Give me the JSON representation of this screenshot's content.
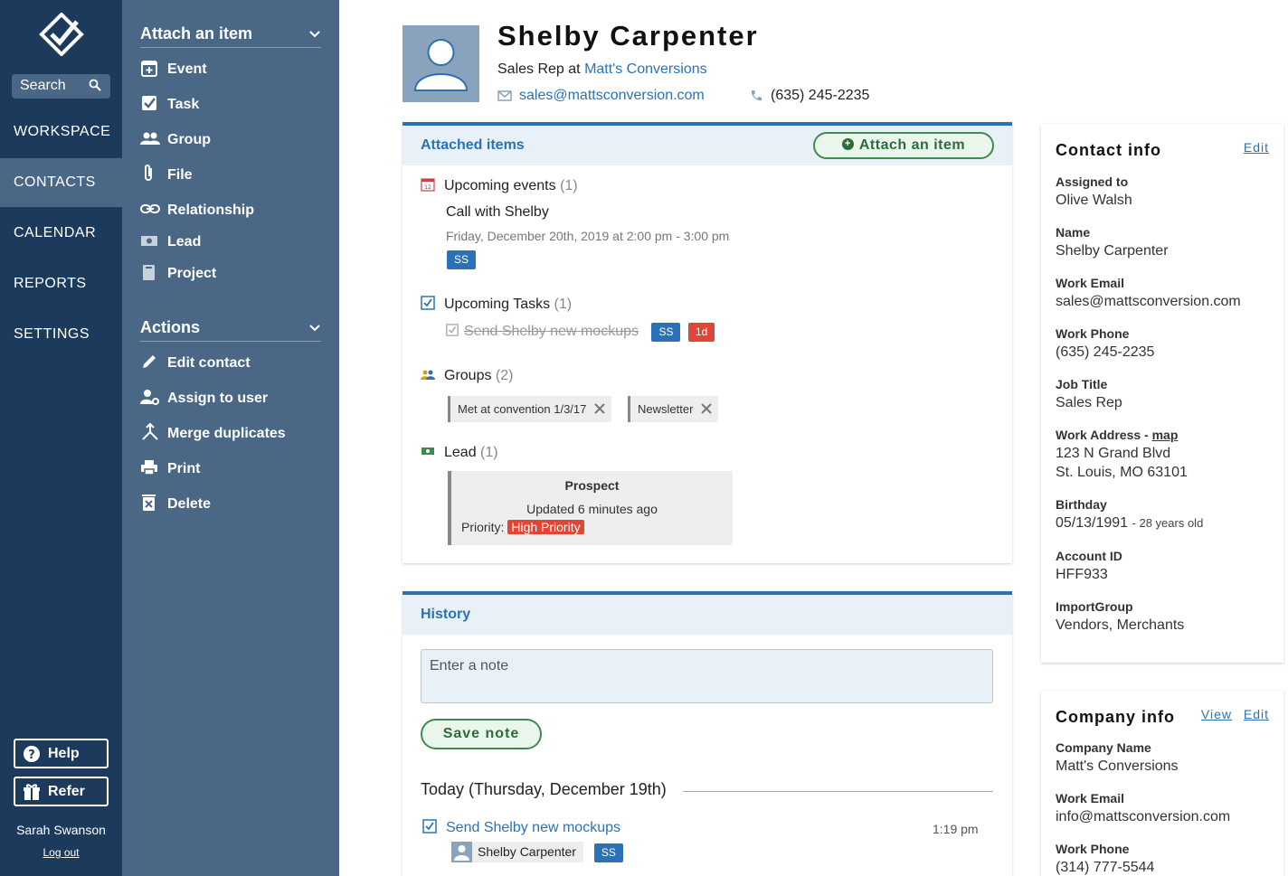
{
  "nav": {
    "search_label": "Search",
    "items": [
      {
        "label": "WORKSPACE"
      },
      {
        "label": "CONTACTS"
      },
      {
        "label": "CALENDAR"
      },
      {
        "label": "REPORTS"
      },
      {
        "label": "SETTINGS"
      }
    ],
    "help_label": "Help",
    "refer_label": "Refer",
    "user_name": "Sarah Swanson",
    "logout_label": "Log out"
  },
  "panel": {
    "attach_heading": "Attach an item",
    "attach_items": [
      {
        "label": "Event",
        "icon": "event-icon"
      },
      {
        "label": "Task",
        "icon": "task-icon"
      },
      {
        "label": "Group",
        "icon": "group-icon"
      },
      {
        "label": "File",
        "icon": "file-icon"
      },
      {
        "label": "Relationship",
        "icon": "relationship-icon"
      },
      {
        "label": "Lead",
        "icon": "lead-icon"
      },
      {
        "label": "Project",
        "icon": "project-icon"
      }
    ],
    "actions_heading": "Actions",
    "action_items": [
      {
        "label": "Edit contact",
        "icon": "pencil-icon"
      },
      {
        "label": "Assign to user",
        "icon": "assign-user-icon"
      },
      {
        "label": "Merge duplicates",
        "icon": "merge-icon"
      },
      {
        "label": "Print",
        "icon": "print-icon"
      },
      {
        "label": "Delete",
        "icon": "trash-icon"
      }
    ]
  },
  "contact": {
    "name": "Shelby Carpenter",
    "role_prefix": "Sales Rep at",
    "company": "Matt's Conversions",
    "email": "sales@mattsconversion.com",
    "phone": "(635) 245-2235"
  },
  "attached": {
    "title": "Attached items",
    "attach_button": "Attach an item",
    "events": {
      "label": "Upcoming events",
      "count": "(1)",
      "event_title": "Call with Shelby",
      "event_time": "Friday, December 20th, 2019 at 2:00 pm - 3:00 pm",
      "badge": "SS"
    },
    "tasks": {
      "label": "Upcoming Tasks",
      "count": "(1)",
      "task_title": "Send Shelby new mockups",
      "badge": "SS",
      "due_badge": "1d"
    },
    "groups": {
      "label": "Groups",
      "count": "(2)",
      "items": [
        "Met at convention 1/3/17",
        "Newsletter"
      ]
    },
    "lead": {
      "label": "Lead",
      "count": "(1)",
      "status": "Prospect",
      "updated": "Updated 6 minutes ago",
      "priority_label": "Priority:",
      "priority": "High Priority"
    }
  },
  "history": {
    "title": "History",
    "note_placeholder": "Enter a note",
    "save_button": "Save note",
    "day_heading": "Today (Thursday, December 19th)",
    "entries": [
      {
        "title": "Send Shelby new mockups",
        "time": "1:19 pm",
        "contact": "Shelby Carpenter",
        "badge": "SS"
      }
    ]
  },
  "contact_info": {
    "title": "Contact info",
    "edit_label": "Edit",
    "assigned_label": "Assigned to",
    "assigned": "Olive Walsh",
    "name_label": "Name",
    "name": "Shelby Carpenter",
    "work_email_label": "Work Email",
    "work_email": "sales@mattsconversion.com",
    "work_phone_label": "Work Phone",
    "work_phone": "(635) 245-2235",
    "job_title_label": "Job Title",
    "job_title": "Sales Rep",
    "address_label": "Work Address -",
    "map_label": "map",
    "address_line1": "123 N Grand Blvd",
    "address_line2": "St. Louis, MO 63101",
    "birthday_label": "Birthday",
    "birthday": "05/13/1991",
    "age": "- 28 years old",
    "account_label": "Account ID",
    "account": "HFF933",
    "import_label": "ImportGroup",
    "import": "Vendors, Merchants"
  },
  "company_info": {
    "title": "Company info",
    "view_label": "View",
    "edit_label": "Edit",
    "company_name_label": "Company Name",
    "company_name": "Matt's Conversions",
    "work_email_label": "Work Email",
    "work_email": "info@mattsconversion.com",
    "work_phone_label": "Work Phone",
    "work_phone": "(314) 777-5544"
  },
  "colors": {
    "nav_bg": "#1b3a5c",
    "panel_bg": "#4a6785",
    "accent": "#2a72b5",
    "green": "#3e8a4f",
    "red": "#e04535"
  }
}
